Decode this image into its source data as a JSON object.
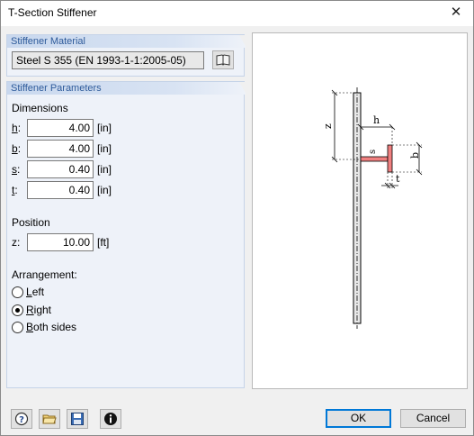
{
  "window": {
    "title": "T-Section Stiffener",
    "close_glyph": "✕"
  },
  "material": {
    "header": "Stiffener Material",
    "value": "Steel S 355 (EN 1993-1-1:2005-05)",
    "library_icon": "book-icon"
  },
  "parameters": {
    "header": "Stiffener Parameters",
    "dimensions_label": "Dimensions",
    "h": {
      "key": "h",
      "suffix": ":",
      "value": "4.00",
      "unit": "[in]"
    },
    "b": {
      "key": "b",
      "suffix": ":",
      "value": "4.00",
      "unit": "[in]"
    },
    "s": {
      "key": "s",
      "suffix": ":",
      "value": "0.40",
      "unit": "[in]"
    },
    "t": {
      "key": "t",
      "suffix": ":",
      "value": "0.40",
      "unit": "[in]"
    },
    "position_label": "Position",
    "z": {
      "key": "z:",
      "value": "10.00",
      "unit": "[ft]"
    },
    "arrangement_label": "Arrangement:",
    "arrangement": [
      {
        "first": "L",
        "rest": "eft",
        "selected": false
      },
      {
        "first": "R",
        "rest": "ight",
        "selected": true
      },
      {
        "first": "B",
        "rest": "oth sides",
        "selected": false
      }
    ]
  },
  "diagram": {
    "label_z": "z",
    "label_h": "h",
    "label_s": "s",
    "label_b": "b",
    "label_t": "t",
    "stiffener_color": "#f08080"
  },
  "footer": {
    "icons": [
      "help-icon",
      "open-icon",
      "save-icon",
      "info-icon"
    ],
    "ok_label": "OK",
    "cancel_label": "Cancel"
  }
}
